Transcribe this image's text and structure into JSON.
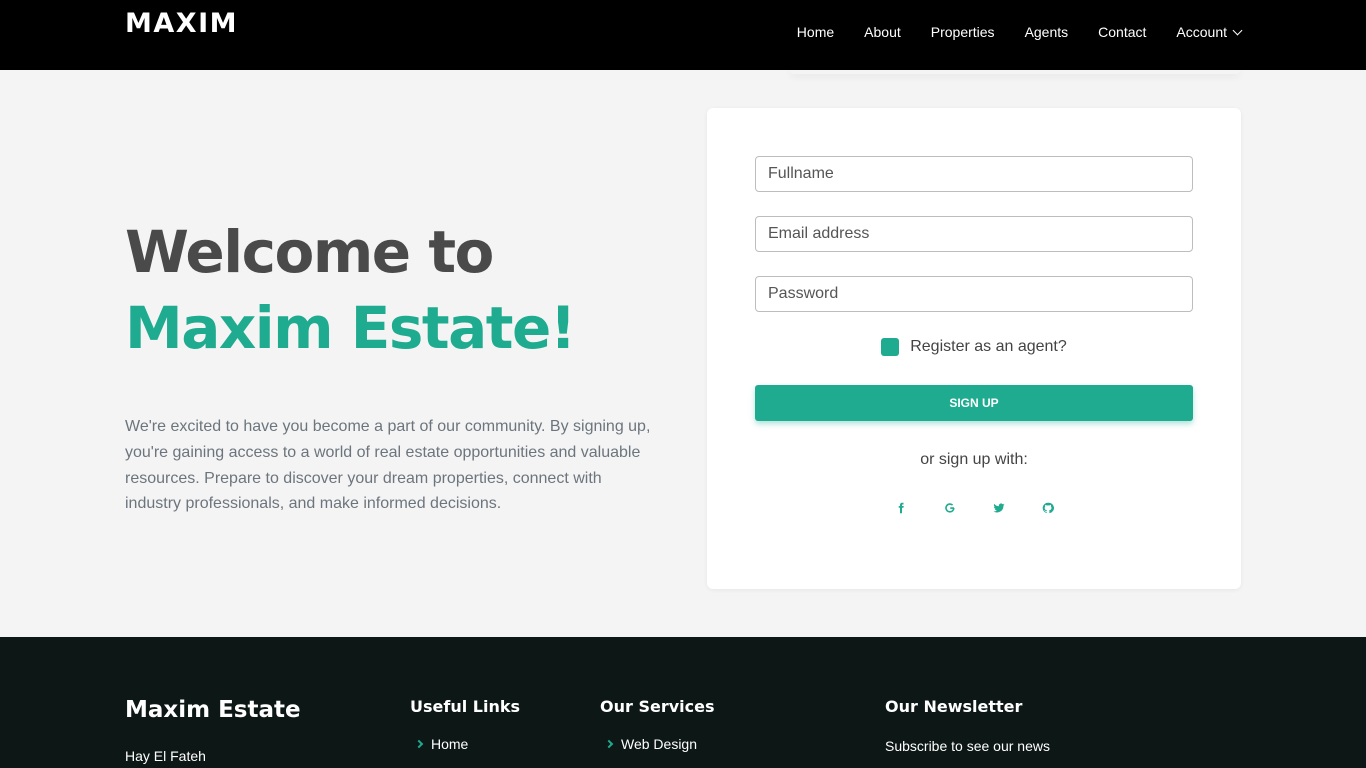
{
  "header": {
    "logo": "MAXIM",
    "nav": [
      "Home",
      "About",
      "Properties",
      "Agents",
      "Contact"
    ],
    "account": "Account"
  },
  "hero": {
    "title_line1": "Welcome to",
    "title_line2": "Maxim Estate!",
    "description": "We're excited to have you become a part of our community. By signing up, you're gaining access to a world of real estate opportunities and valuable resources. Prepare to discover your dream properties, connect with industry professionals, and make informed decisions."
  },
  "form": {
    "fullname_placeholder": "Fullname",
    "email_placeholder": "Email address",
    "password_placeholder": "Password",
    "agent_checkbox_label": "Register as an agent?",
    "agent_checked": true,
    "submit_label": "SIGN UP",
    "or_text": "or sign up with:",
    "socials": [
      "facebook-icon",
      "google-icon",
      "twitter-icon",
      "github-icon"
    ]
  },
  "footer": {
    "brand": "Maxim Estate",
    "address": "Hay El Fateh",
    "useful_links_title": "Useful Links",
    "useful_links": [
      "Home"
    ],
    "services_title": "Our Services",
    "services": [
      "Web Design"
    ],
    "newsletter_title": "Our Newsletter",
    "newsletter_text": "Subscribe to see our news"
  },
  "colors": {
    "accent": "#1fab8f",
    "header_bg": "#000000",
    "footer_bg": "#0d1716",
    "page_bg": "#f4f4f4"
  }
}
